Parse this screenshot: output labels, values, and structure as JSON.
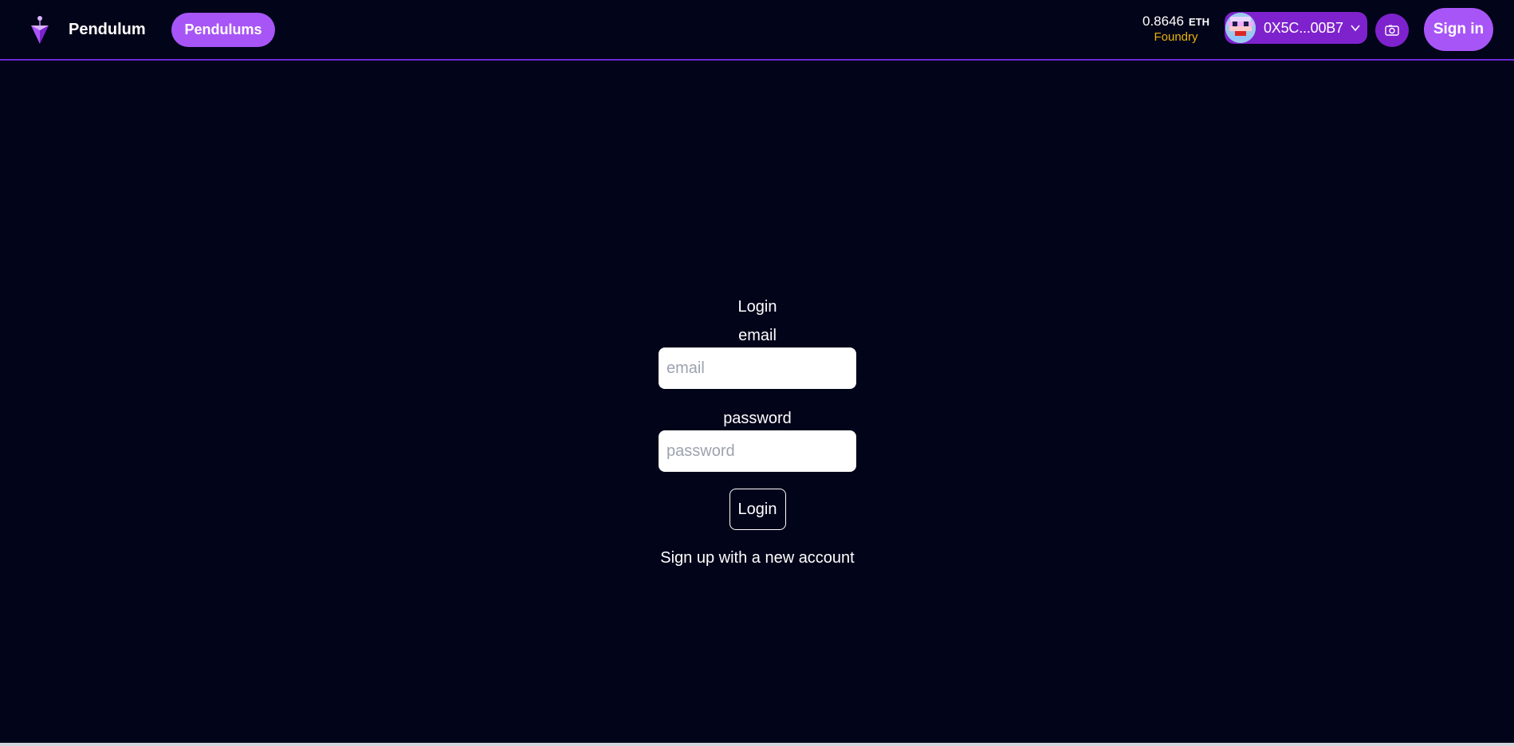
{
  "colors": {
    "background": "#02041a",
    "accent": "#a855f7",
    "account_bg": "#7e22ce",
    "network": "#eab308",
    "divider": "#6d28d9"
  },
  "header": {
    "brand_name": "Pendulum",
    "logo_icon": "pendulum-logo-icon",
    "nav_button": "Pendulums",
    "balance_amount": "0.8646",
    "balance_unit": "ETH",
    "network": "Foundry",
    "account_address": "0X5C...00B7",
    "account_menu_icon": "chevron-down-icon",
    "wallet_icon": "camera-icon",
    "signin_button": "Sign in"
  },
  "login": {
    "title": "Login",
    "email_label": "email",
    "email_placeholder": "email",
    "email_value": "",
    "password_label": "password",
    "password_placeholder": "password",
    "password_value": "",
    "submit_button": "Login",
    "signup_link": "Sign up with a new account"
  }
}
